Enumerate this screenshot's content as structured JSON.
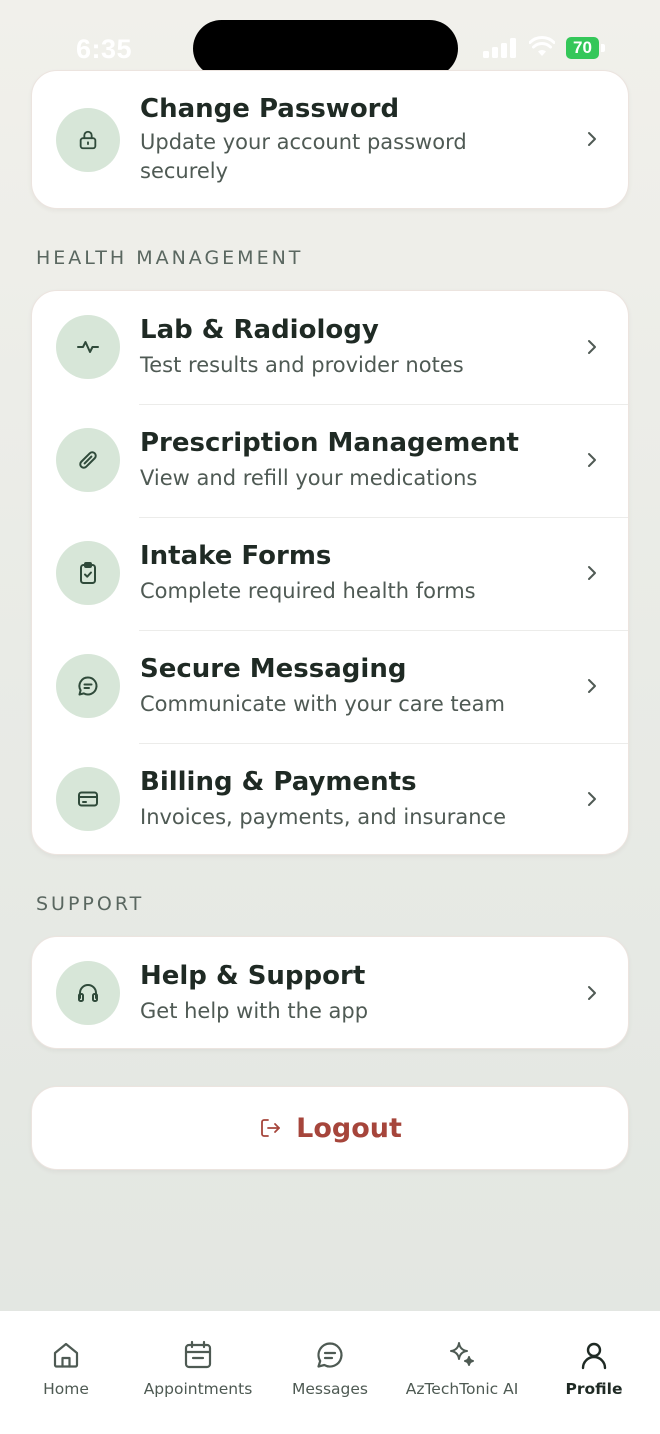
{
  "status_bar": {
    "time": "6:35",
    "battery": "70"
  },
  "account_section": {
    "items": [
      {
        "title": "Change Password",
        "subtitle_line1": "Update your account password",
        "subtitle_line2": "securely",
        "icon": "lock-icon"
      }
    ]
  },
  "health_section": {
    "header": "HEALTH MANAGEMENT",
    "items": [
      {
        "title": "Lab & Radiology",
        "subtitle": "Test results and provider notes",
        "icon": "activity-icon"
      },
      {
        "title": "Prescription Management",
        "subtitle": "View and refill your medications",
        "icon": "pill-icon"
      },
      {
        "title": "Intake Forms",
        "subtitle": "Complete required health forms",
        "icon": "clipboard-check-icon"
      },
      {
        "title": "Secure Messaging",
        "subtitle": "Communicate with your care team",
        "icon": "message-icon"
      },
      {
        "title": "Billing & Payments",
        "subtitle": "Invoices, payments, and insurance",
        "icon": "credit-card-icon"
      }
    ]
  },
  "support_section": {
    "header": "SUPPORT",
    "items": [
      {
        "title": "Help & Support",
        "subtitle": "Get help with the app",
        "icon": "headphones-icon"
      }
    ]
  },
  "logout": {
    "label": "Logout",
    "icon": "logout-icon",
    "color": "#a6453b"
  },
  "tab_bar": {
    "active": "Profile",
    "tabs": [
      {
        "label": "Home",
        "icon": "home-icon"
      },
      {
        "label": "Appointments",
        "icon": "calendar-icon"
      },
      {
        "label": "Messages",
        "icon": "chat-icon"
      },
      {
        "label": "AzTechTonic AI",
        "icon": "sparkles-icon"
      },
      {
        "label": "Profile",
        "icon": "user-icon"
      }
    ]
  },
  "colors": {
    "icon_circle": "#d7e6d8",
    "icon_stroke": "#2f4a3a",
    "background": "#e9ebe6",
    "battery": "#34c759"
  }
}
